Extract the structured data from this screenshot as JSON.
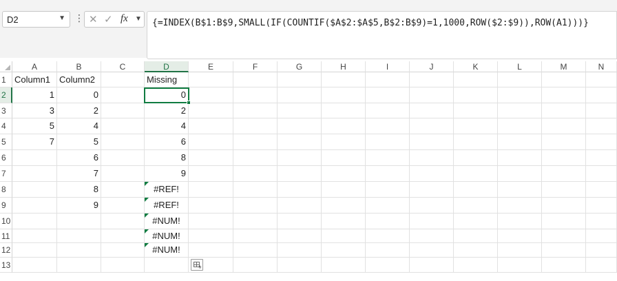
{
  "formula_bar": {
    "name_box": "D2",
    "fx_label": "fx",
    "formula": "{=INDEX(B$1:B$9,SMALL(IF(COUNTIF($A$2:$A$5,B$2:B$9)=1,1000,ROW($2:$9)),ROW(A1)))}"
  },
  "columns": [
    "A",
    "B",
    "C",
    "D",
    "E",
    "F",
    "G",
    "H",
    "I",
    "J",
    "K",
    "L",
    "M",
    "N"
  ],
  "rows": [
    "1",
    "2",
    "3",
    "4",
    "5",
    "6",
    "7",
    "8",
    "9",
    "10",
    "11",
    "12",
    "13"
  ],
  "selected": {
    "column": "D",
    "row": "2",
    "cell": "D2"
  },
  "cells": {
    "A1": "Column1",
    "B1": "Column2",
    "D1": "Missing",
    "A2": "1",
    "B2": "0",
    "D2": "0",
    "A3": "3",
    "B3": "2",
    "D3": "2",
    "A4": "5",
    "B4": "4",
    "D4": "4",
    "A5": "7",
    "B5": "5",
    "D5": "6",
    "B6": "6",
    "D6": "8",
    "B7": "7",
    "D7": "9",
    "B8": "8",
    "D8": "#REF!",
    "B9": "9",
    "D9": "#REF!",
    "D10": "#NUM!",
    "D11": "#NUM!",
    "D12": "#NUM!"
  },
  "colors": {
    "selection_green": "#107c41",
    "header_highlight": "#e4ede6",
    "gridline": "#e1e1e1"
  }
}
